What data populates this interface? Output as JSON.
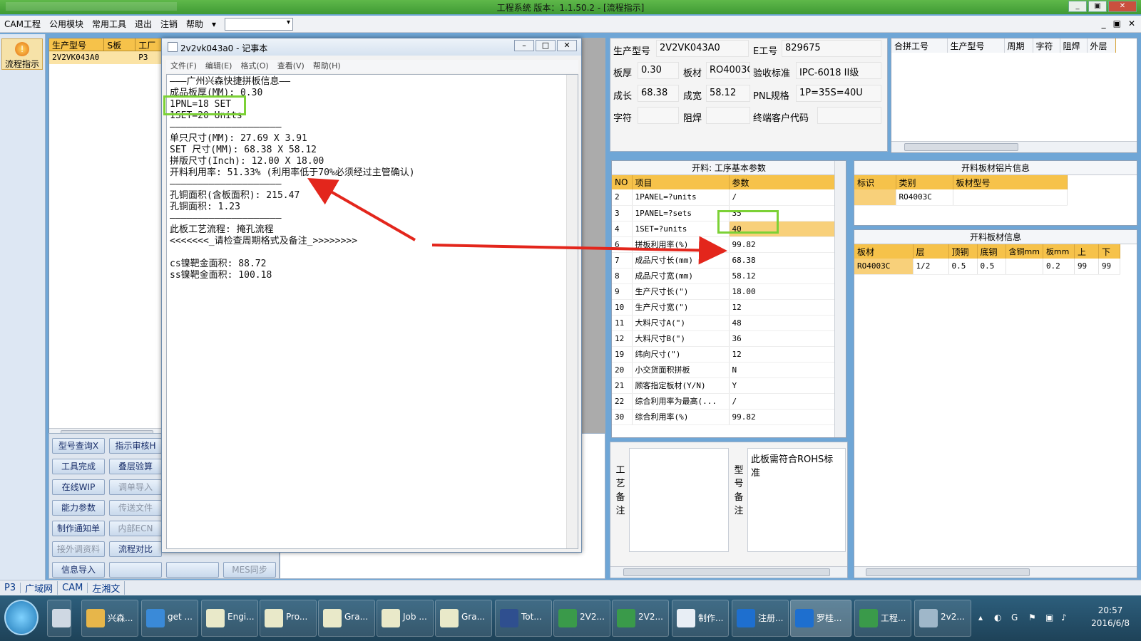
{
  "window": {
    "title": "工程系统   版本：1.1.50.2 - [流程指示]"
  },
  "menu": {
    "items": [
      "CAM工程",
      "公用模块",
      "常用工具",
      "退出",
      "注销",
      "帮助"
    ],
    "right_controls": [
      "_",
      "▣",
      "✕"
    ]
  },
  "left": {
    "flow_button": "流程指示",
    "product_list": {
      "headers": [
        "生产型号",
        "S板",
        "工厂"
      ],
      "rows": [
        [
          "2V2VK043A0",
          "",
          "P3"
        ]
      ]
    },
    "buttons": [
      [
        "型号查询X",
        "指示审核H"
      ],
      [
        "工具完成",
        "叠层验算"
      ],
      [
        "在线WIP",
        "调单导入"
      ],
      [
        "能力参数",
        "传送文件"
      ],
      [
        "制作通知单",
        "内部ECN"
      ],
      [
        "接外调资料",
        "流程对比"
      ],
      [
        "信息导入",
        "",
        "",
        "MES同步"
      ]
    ]
  },
  "notepad": {
    "title": "2v2vk043a0 - 记事本",
    "menu": [
      "文件(F)",
      "编辑(E)",
      "格式(O)",
      "查看(V)",
      "帮助(H)"
    ],
    "lines": [
      "———广州兴森快捷拼板信息——",
      "成品板厚(MM): 0.30",
      "1PNL=18 SET",
      "1SET=20 Units",
      "————————————————————",
      "单只尺寸(MM): 27.69 X 3.91",
      "SET 尺寸(MM): 68.38 X 58.12",
      "拼版尺寸(Inch): 12.00 X 18.00",
      "开料利用率: 51.33% (利用率低于70%必须经过主管确认)",
      "————————————————————",
      "孔铜面积(含板面积): 215.47",
      "孔铜面积: 1.23",
      "————————————————————",
      "此板工艺流程: 掩孔流程",
      "<<<<<<<_请检查周期格式及备注_>>>>>>>>",
      "",
      "cs镍靶金面积: 88.72",
      "ss镍靶金面积: 100.18"
    ]
  },
  "info": {
    "prod_model_label": "生产型号",
    "prod_model": "2V2VK043A0",
    "e_no_label": "E工号",
    "e_no": "829675",
    "thickness_label": "板厚",
    "thickness": "0.30",
    "material_label": "板材",
    "material": "RO4003C",
    "std_label": "验收标准",
    "std": "IPC-6018 II级",
    "length_label": "成长",
    "length": "68.38",
    "width_label": "成宽",
    "width": "58.12",
    "pnl_label": "PNL规格",
    "pnl": "1P=35S=40U",
    "char_label": "字符",
    "char": "",
    "mask_label": "阻焊",
    "mask": "",
    "customer_label": "终端客户代码",
    "customer": ""
  },
  "merge_grid": {
    "headers": [
      "合拼工号",
      "生产型号",
      "周期",
      "字符",
      "阻焊",
      "外层"
    ]
  },
  "cut_grid": {
    "caption": "开料: 工序基本参数",
    "headers": [
      "NO",
      "项目",
      "参数"
    ],
    "rows": [
      [
        "2",
        "1PANEL=?units",
        "/"
      ],
      [
        "3",
        "1PANEL=?sets",
        "35"
      ],
      [
        "4",
        "1SET=?units",
        "40"
      ],
      [
        "6",
        "拼板利用率(%)",
        "99.82"
      ],
      [
        "7",
        "成品尺寸长(mm)",
        "68.38"
      ],
      [
        "8",
        "成品尺寸宽(mm)",
        "58.12"
      ],
      [
        "9",
        "生产尺寸长(\")",
        "18.00"
      ],
      [
        "10",
        "生产尺寸宽(\")",
        "12"
      ],
      [
        "11",
        "大料尺寸A(\")",
        "48"
      ],
      [
        "12",
        "大料尺寸B(\")",
        "36"
      ],
      [
        "19",
        "纬向尺寸(\")",
        "12"
      ],
      [
        "20",
        "小交货面积拼板",
        "N"
      ],
      [
        "21",
        "顾客指定板材(Y/N)",
        "Y"
      ],
      [
        "22",
        "综合利用率为最高(...",
        "/"
      ],
      [
        "30",
        "综合利用率(%)",
        "99.82"
      ]
    ]
  },
  "foil_grid": {
    "caption": "开料板材铝片信息",
    "headers": [
      "标识",
      "类别",
      "板材型号"
    ],
    "rows": [
      [
        "",
        "RO4003C",
        ""
      ]
    ]
  },
  "mat_grid": {
    "caption": "开料板材信息",
    "headers": [
      "板材",
      "层",
      "顶铜",
      "底铜",
      "含铜mm",
      "板mm",
      "上",
      "下"
    ],
    "rows": [
      [
        "RO4003C",
        "1/2",
        "0.5",
        "0.5",
        "",
        "0.2",
        "99",
        "99"
      ]
    ]
  },
  "remarks": {
    "process_label": "工艺备注",
    "process_text": "",
    "model_label": "型号备注",
    "model_text": "此板需符合ROHS标准"
  },
  "status": {
    "items": [
      "P3",
      "广域网",
      "CAM",
      "左湘文"
    ]
  },
  "taskbar": {
    "items": [
      "兴森...",
      "get ...",
      "Engi...",
      "Pro...",
      "Gra...",
      "Job ...",
      "Gra...",
      "Tot...",
      "2V2...",
      "2V2...",
      "制作...",
      "注册...",
      "罗桂...",
      "工程...",
      "2v2..."
    ],
    "time": "20:57",
    "date": "2016/6/8"
  }
}
